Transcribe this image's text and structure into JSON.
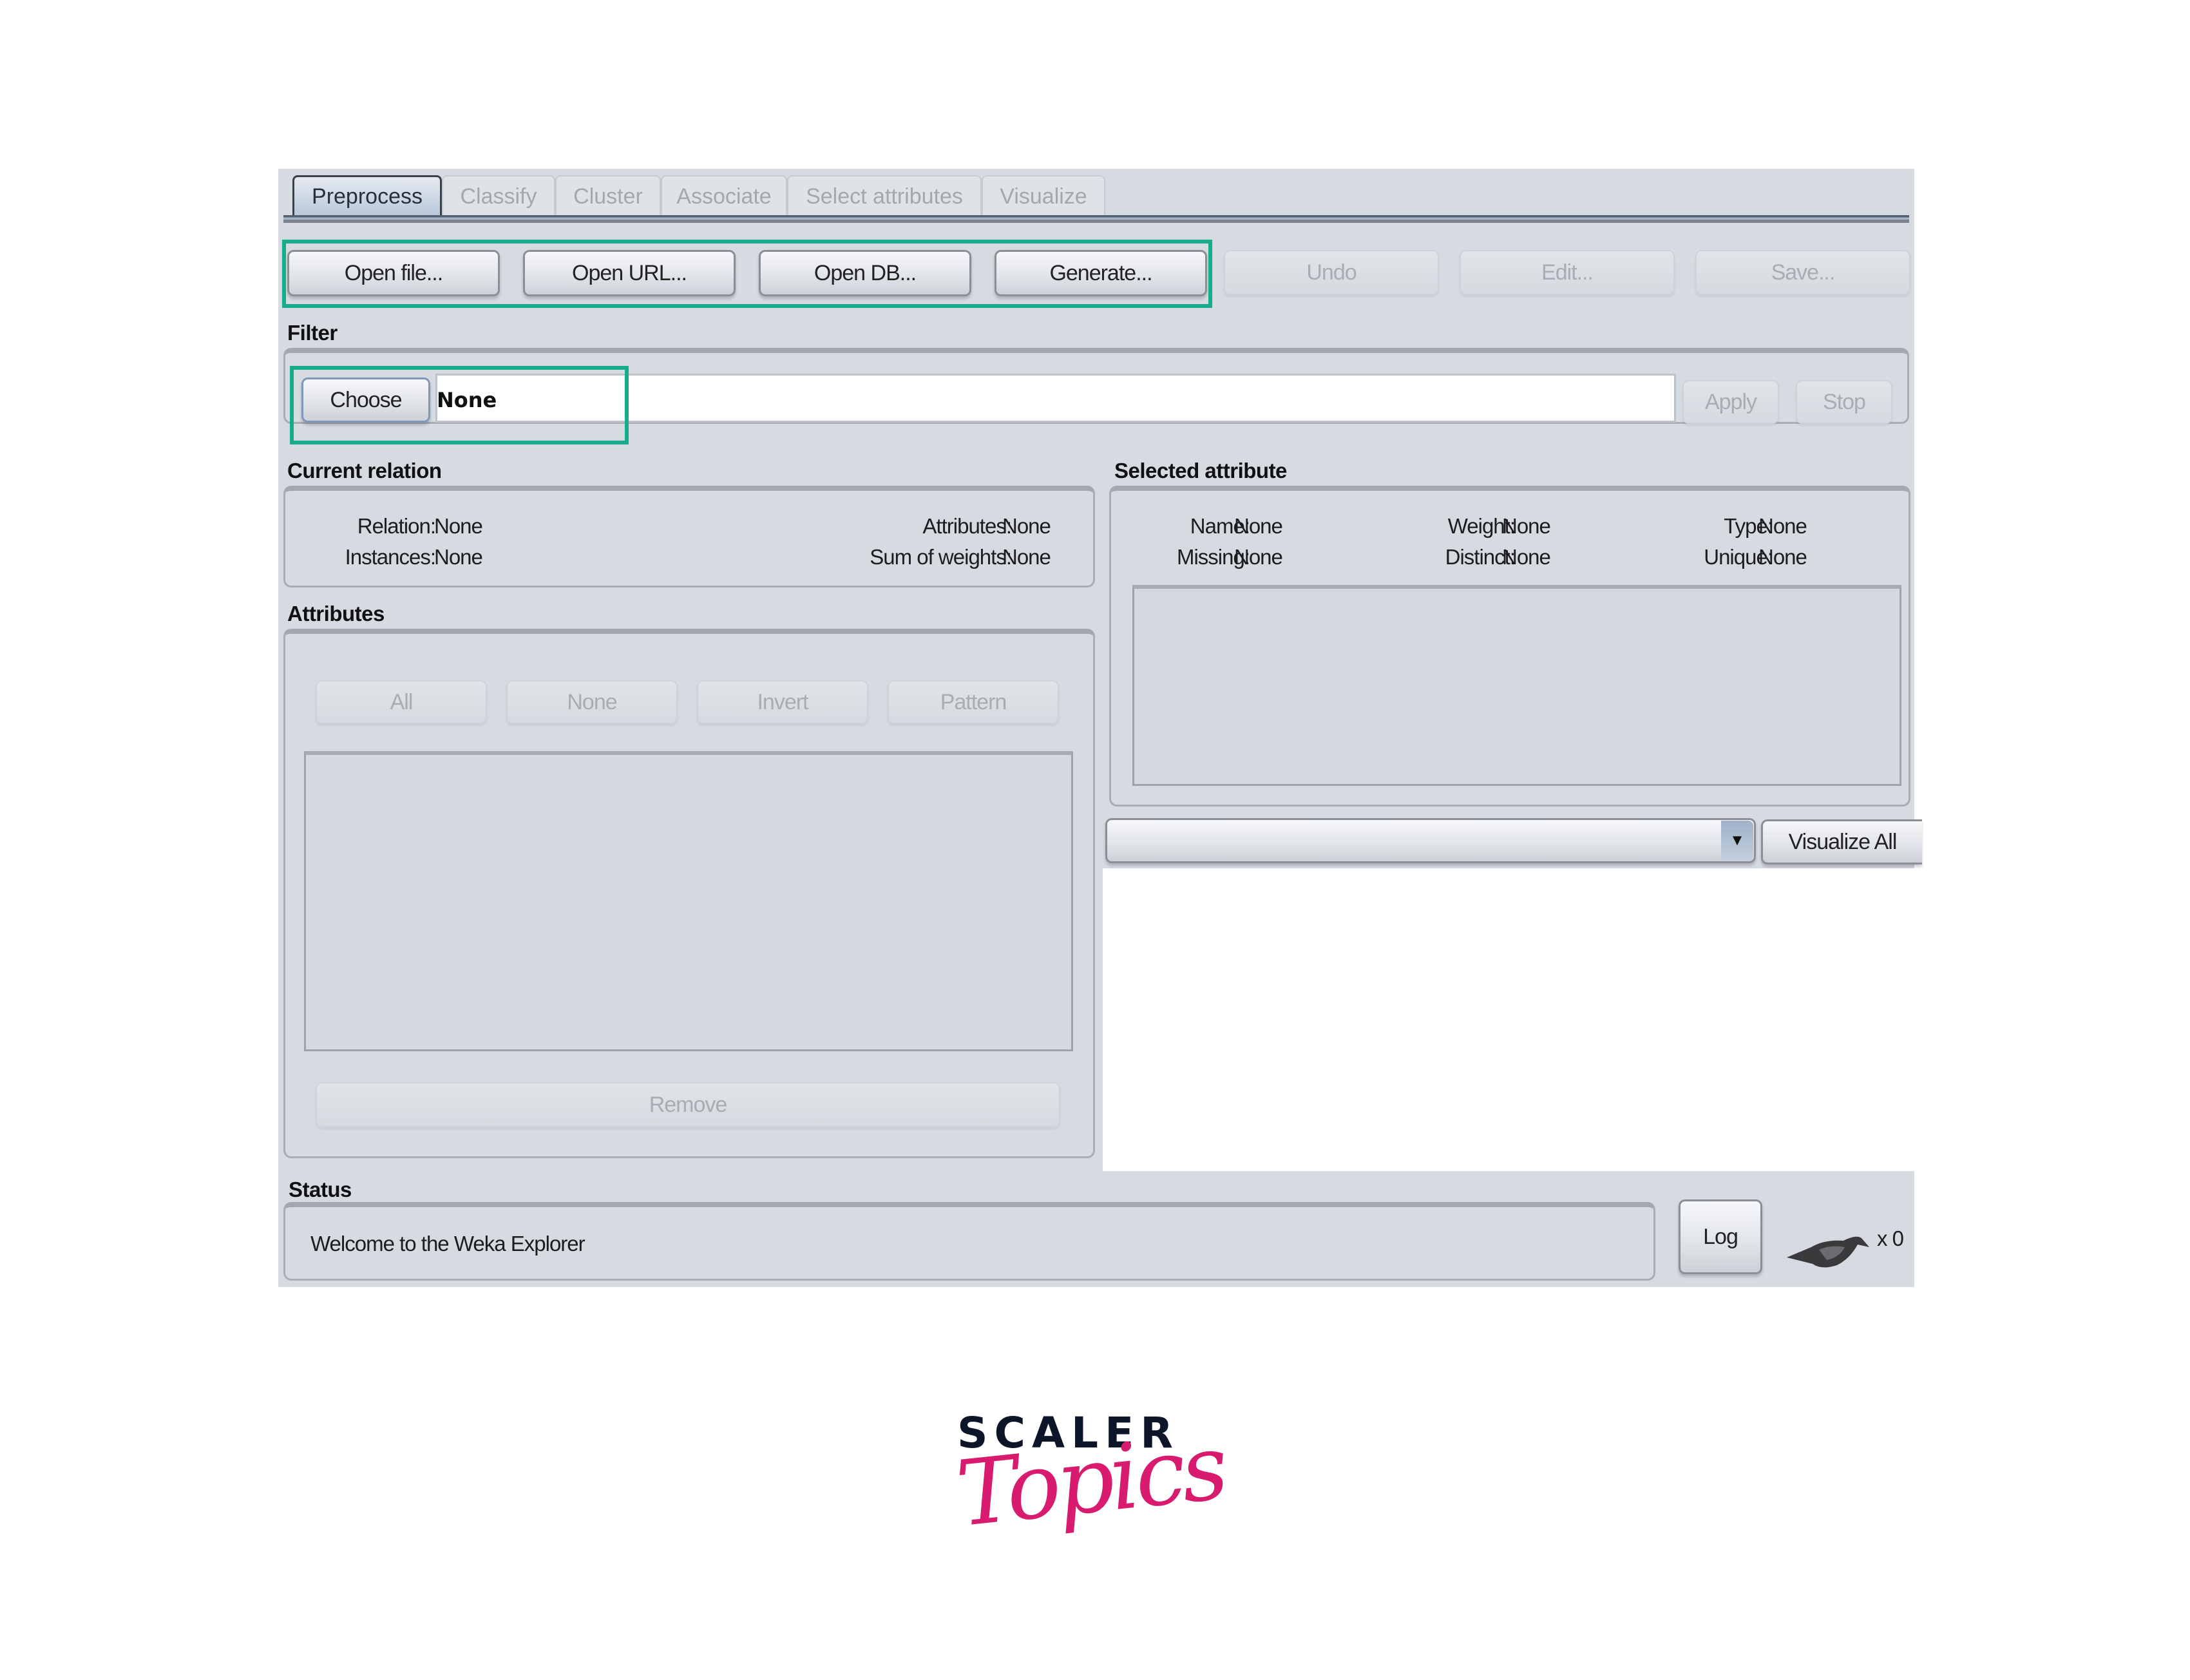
{
  "tabs": [
    {
      "label": "Preprocess",
      "active": true
    },
    {
      "label": "Classify",
      "active": false
    },
    {
      "label": "Cluster",
      "active": false
    },
    {
      "label": "Associate",
      "active": false
    },
    {
      "label": "Select attributes",
      "active": false
    },
    {
      "label": "Visualize",
      "active": false
    }
  ],
  "toolbar": {
    "open_file": "Open file...",
    "open_url": "Open URL...",
    "open_db": "Open DB...",
    "generate": "Generate...",
    "undo": "Undo",
    "edit": "Edit...",
    "save": "Save..."
  },
  "filter": {
    "section_label": "Filter",
    "choose_label": "Choose",
    "value": "None",
    "apply_label": "Apply",
    "stop_label": "Stop"
  },
  "current_relation": {
    "section_label": "Current relation",
    "relation_label": "Relation:",
    "relation_value": "None",
    "instances_label": "Instances:",
    "instances_value": "None",
    "attributes_label": "Attributes:",
    "attributes_value": "None",
    "sum_weights_label": "Sum of weights:",
    "sum_weights_value": "None"
  },
  "attributes": {
    "section_label": "Attributes",
    "all_label": "All",
    "none_label": "None",
    "invert_label": "Invert",
    "pattern_label": "Pattern",
    "remove_label": "Remove"
  },
  "selected_attribute": {
    "section_label": "Selected attribute",
    "name_label": "Name:",
    "name_value": "None",
    "weight_label": "Weight:",
    "weight_value": "None",
    "type_label": "Type:",
    "type_value": "None",
    "missing_label": "Missing:",
    "missing_value": "None",
    "distinct_label": "Distinct:",
    "distinct_value": "None",
    "unique_label": "Unique:",
    "unique_value": "None"
  },
  "visualize": {
    "class_select_value": "",
    "dropdown_arrow": "▼",
    "visualize_all_label": "Visualize All"
  },
  "status": {
    "section_label": "Status",
    "message": "Welcome to the Weka Explorer",
    "log_label": "Log",
    "task_count": "x 0",
    "status_icon": "weka-bird-icon"
  },
  "highlight_color": "#17ad8c",
  "branding": {
    "line1": "SCALER",
    "line2": "Topics",
    "line1_color": "#0d1628",
    "line2_color": "#d81b6e"
  }
}
